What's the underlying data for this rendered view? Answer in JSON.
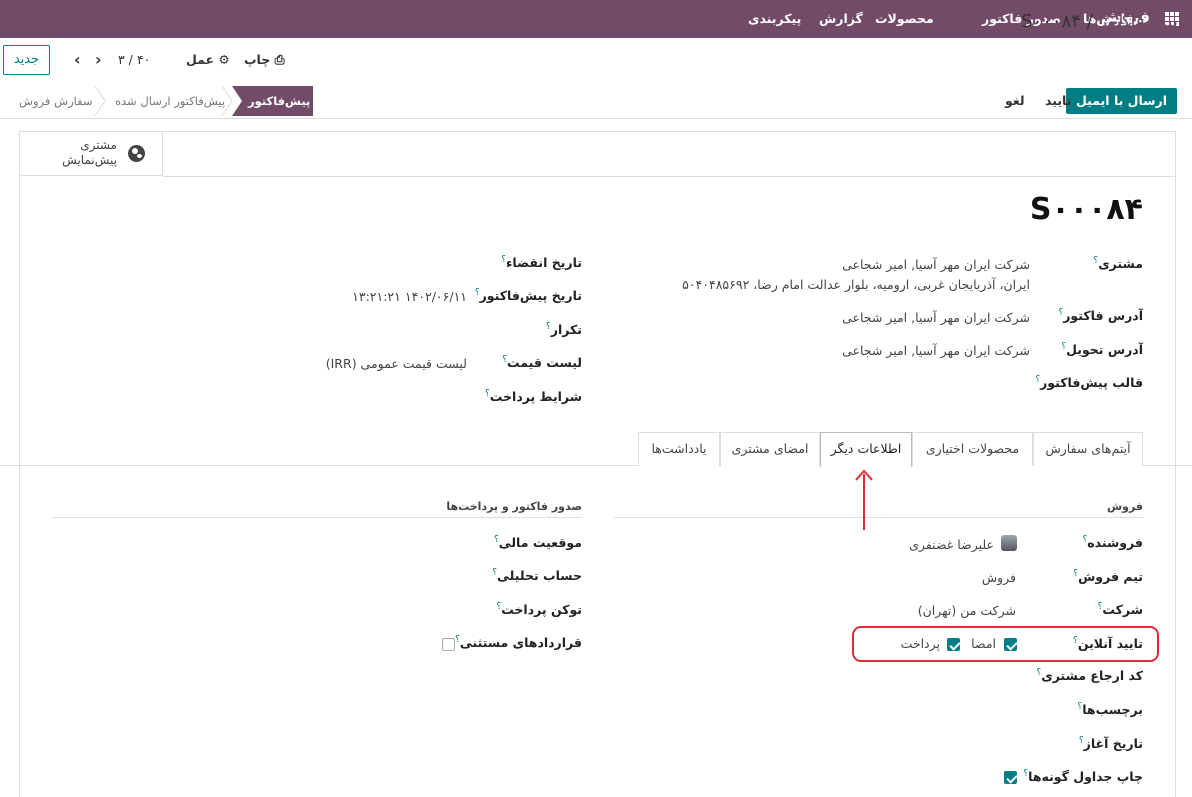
{
  "topbar": {
    "brand": "فروش",
    "menu": [
      "سفارش‌ها",
      "صدور فاکتور",
      "محصولات",
      "گزارش",
      "پیکربندی"
    ]
  },
  "control_panel": {
    "breadcrumb_parent": "پیش‌فاکتور",
    "breadcrumb_sep": "/",
    "breadcrumb_current": "S۰۰۰۸۴",
    "new_label": "جدید",
    "pager": "۳ / ۴۰",
    "print_label": "چاپ",
    "action_label": "عمل"
  },
  "statusbar": {
    "send_email": "ارسال با ایمیل",
    "confirm": "تایید",
    "cancel": "لغو",
    "stages": [
      "پیش‌فاکتور",
      "پیش‌فاکتور ارسال شده",
      "سفارش فروش"
    ]
  },
  "smart_button": {
    "line1": "مشتری",
    "line2": "پیش‌نمایش"
  },
  "form": {
    "title": "S۰۰۰۸۴",
    "customer_label": "مشتری",
    "customer_name": "شرکت ایران مهر آسیا, امیر شجاعی",
    "customer_address": "ایران، آذربایجان غربی، ارومیه، بلوار عدالت امام رضا، ۵۰۴۰۴۸۵۶۹۲",
    "invoice_address_label": "آدرس فاکتور",
    "invoice_address": "شرکت ایران مهر آسیا, امیر شجاعی",
    "delivery_address_label": "آدرس تحویل",
    "delivery_address": "شرکت ایران مهر آسیا, امیر شجاعی",
    "template_label": "قالب پیش‌فاکتور",
    "expiration_label": "تاریخ انقضاء",
    "quotation_date_label": "تاریخ پیش‌فاکتور",
    "quotation_date": "۱۴۰۲/۰۶/۱۱ ۱۳:۲۱:۲۱",
    "recurrence_label": "تکرار",
    "pricelist_label": "لیست قیمت",
    "pricelist": "لیست قیمت عمومی (IRR)",
    "payment_terms_label": "شرایط پرداخت",
    "help_mark": "؟"
  },
  "tabs": [
    "آیتم‌های سفارش",
    "محصولات اختیاری",
    "اطلاعات دیگر",
    "امضای مشتری",
    "یادداشت‌ها"
  ],
  "other_info": {
    "sales_section": "فروش",
    "salesperson_label": "فروشنده",
    "salesperson": "علیرضا غضنفری",
    "team_label": "تیم فروش",
    "team": "فروش",
    "company_label": "شرکت",
    "company": "شرکت من (تهران)",
    "online_confirm_label": "تایید آنلاین",
    "signature_label": "امضا",
    "payment_label": "پرداخت",
    "customer_ref_label": "کد ارجاع مشتری",
    "tags_label": "برچسب‌ها",
    "start_date_label": "تاریخ آغاز",
    "print_variants_label": "چاپ جداول گونه‌ها",
    "invoicing_section": "صدور فاکتور و پرداخت‌ها",
    "fiscal_position_label": "موقعیت مالی",
    "analytic_account_label": "حساب تحلیلی",
    "payment_token_label": "توکن پرداخت",
    "contracts_label": "قراردادهای مستثنی"
  },
  "colors": {
    "brand": "#714b67",
    "accent": "#017e84",
    "annotation": "#e02a3a"
  }
}
